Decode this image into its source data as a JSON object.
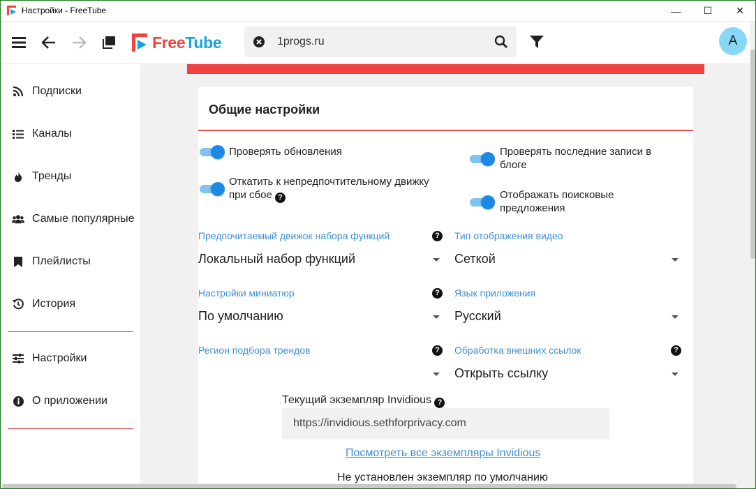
{
  "window": {
    "title": "Настройки - FreeTube",
    "minimize": "—",
    "maximize": "☐",
    "close": "✕"
  },
  "topnav": {
    "logo_free": "Free",
    "logo_tube": "Tube",
    "search_value": "1progs.ru",
    "avatar_letter": "A"
  },
  "sidebar": {
    "items": [
      {
        "label": "Подписки",
        "icon": "rss-icon"
      },
      {
        "label": "Каналы",
        "icon": "list-icon"
      },
      {
        "label": "Тренды",
        "icon": "fire-icon"
      },
      {
        "label": "Самые популярные",
        "icon": "users-icon"
      },
      {
        "label": "Плейлисты",
        "icon": "bookmark-icon"
      },
      {
        "label": "История",
        "icon": "history-icon"
      },
      {
        "label": "Настройки",
        "icon": "sliders-icon"
      },
      {
        "label": "О приложении",
        "icon": "info-icon"
      }
    ]
  },
  "settings": {
    "title": "Общие настройки",
    "toggles": {
      "check_updates": {
        "label": "Проверять обновления",
        "on": true
      },
      "check_blog": {
        "label_1": "Проверять последние записи в",
        "label_2": "блоге",
        "on": true
      },
      "fallback": {
        "label_1": "Откатить к непредпочтительному движку",
        "label_2": "при сбое",
        "on": true
      },
      "search_suggestions": {
        "label_1": "Отображать поисковые",
        "label_2": "предложения",
        "on": true
      }
    },
    "selects": {
      "backend": {
        "label": "Предпочитаемый движок набора функций",
        "value": "Локальный набор функций"
      },
      "video_view": {
        "label": "Тип отображения видео",
        "value": "Сеткой"
      },
      "thumbnails": {
        "label": "Настройки миниатюр",
        "value": "По умолчанию"
      },
      "language": {
        "label": "Язык приложения",
        "value": "Русский"
      },
      "trend_region": {
        "label": "Регион подбора трендов",
        "value": ""
      },
      "external_links": {
        "label": "Обработка внешних ссылок",
        "value": "Открыть ссылку"
      }
    },
    "invidious": {
      "label": "Текущий экземпляр Invidious",
      "value": "https://invidious.sethforprivacy.com",
      "link": "Посмотреть все экземпляры Invidious",
      "note": "Не установлен экземпляр по умолчанию"
    },
    "help_glyph": "?"
  },
  "colors": {
    "accent_red": "#f04242",
    "accent_blue": "#1e88e5",
    "link_blue": "#3d8fd6",
    "avatar_bg": "#87d8f7"
  }
}
